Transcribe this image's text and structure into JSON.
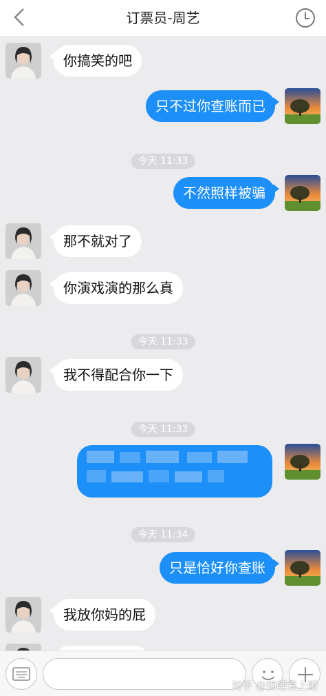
{
  "header": {
    "title": "订票员-周艺",
    "back_icon": "chevron-left-icon",
    "history_icon": "clock-icon"
  },
  "messages": [
    {
      "from": "contact",
      "text": "你搞笑的吧"
    },
    {
      "from": "me",
      "text": "只不过你查账而已"
    },
    {
      "type": "time",
      "text": "今天 11:33"
    },
    {
      "from": "me",
      "text": "不然照样被骗"
    },
    {
      "from": "contact",
      "text": "那不就对了"
    },
    {
      "from": "contact",
      "text": "你演戏演的那么真"
    },
    {
      "type": "time",
      "text": "今天 11:33"
    },
    {
      "from": "contact",
      "text": "我不得配合你一下"
    },
    {
      "type": "time",
      "text": "今天 11:33"
    },
    {
      "from": "me",
      "text": "",
      "blurred": true
    },
    {
      "type": "time",
      "text": "今天 11:34"
    },
    {
      "from": "me",
      "text": "只是恰好你查账"
    },
    {
      "from": "contact",
      "text": "我放你妈的屁"
    }
  ],
  "input_bar": {
    "keyboard_icon": "keyboard-icon",
    "placeholder": "",
    "emoji_icon": "smile-icon",
    "plus_icon": "plus-icon"
  },
  "watermark": "知乎 @锦鲤爱上鲲",
  "colors": {
    "outgoing_bubble": "#1c8ff8",
    "incoming_bubble": "#ffffff",
    "background": "#ececee"
  }
}
